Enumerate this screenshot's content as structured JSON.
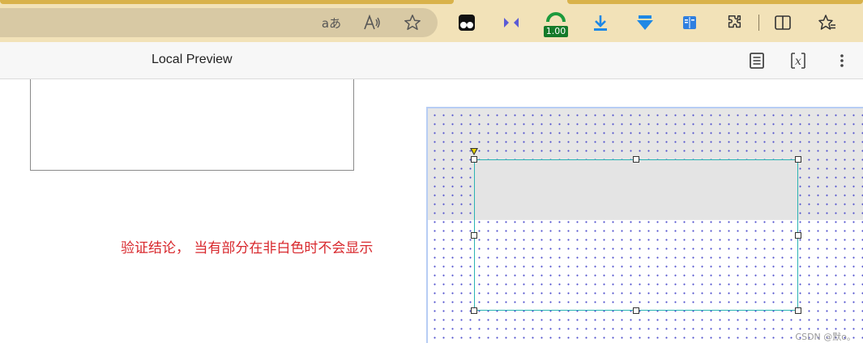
{
  "browser": {
    "toolbar_icons": [
      "read-aloud-translate-icon",
      "read-aloud-icon",
      "favorite-star-icon",
      "extension-tampermonkey-icon",
      "extension-bowtie-icon",
      "extension-speed-icon",
      "download-icon",
      "download-arrow-icon",
      "extension-book-icon",
      "extensions-puzzle-icon",
      "split-screen-icon",
      "favorites-icon"
    ],
    "translate_glyph": "aあ",
    "speed_badge": "1.00",
    "accent_color": "#f2e2b8"
  },
  "preview": {
    "title": "Local Preview",
    "icons": [
      "document-view-icon",
      "formula-icon",
      "more-vertical-icon"
    ]
  },
  "content": {
    "note": "验证结论， 当有部分在非白色时不会显示",
    "note_color": "#d8282d",
    "selection_color": "#2bb3b3",
    "watermark": "CSDN @默o。"
  }
}
